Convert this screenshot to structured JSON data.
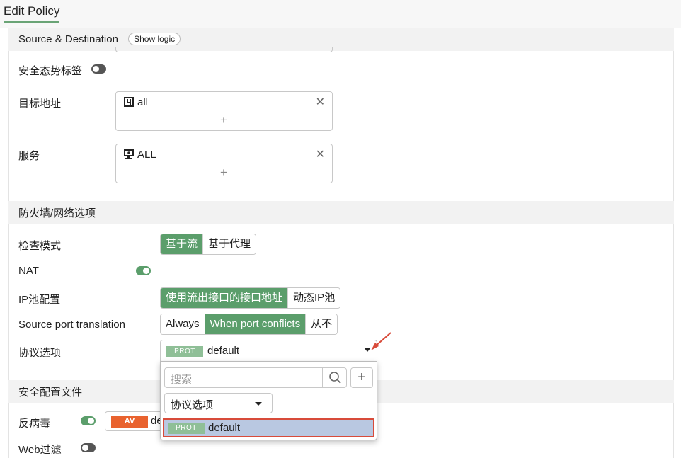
{
  "header": {
    "title": "Edit Policy"
  },
  "source_destination": {
    "heading": "Source & Destination",
    "show_logic": "Show logic",
    "security_tag": {
      "label": "安全态势标签",
      "enabled": false
    },
    "destination": {
      "label": "目标地址",
      "value": "all"
    },
    "service": {
      "label": "服务",
      "value": "ALL"
    }
  },
  "firewall": {
    "heading": "防火墙/网络选项",
    "inspection_mode": {
      "label": "检查模式",
      "options": [
        "基于流",
        "基于代理"
      ],
      "selected": "基于流"
    },
    "nat": {
      "label": "NAT",
      "enabled": true
    },
    "ip_pool": {
      "label": "IP池配置",
      "options": [
        "使用流出接口的接口地址",
        "动态IP池"
      ],
      "selected": "使用流出接口的接口地址"
    },
    "source_port": {
      "label": "Source port translation",
      "options": [
        "Always",
        "When port conflicts",
        "从不"
      ],
      "selected": "When port conflicts"
    },
    "protocol": {
      "label": "协议选项",
      "tag": "PROT",
      "value": "default"
    }
  },
  "dropdown": {
    "search_placeholder": "搜索",
    "add_symbol": "+",
    "filter_label": "协议选项",
    "options": [
      {
        "tag": "PROT",
        "label": "default"
      }
    ]
  },
  "security_profiles": {
    "heading": "安全配置文件",
    "antivirus": {
      "label": "反病毒",
      "enabled": true,
      "tag": "AV",
      "value": "de"
    },
    "web_filter": {
      "label": "Web过滤",
      "enabled": false
    }
  },
  "colors": {
    "accent_green": "#5b9e6b",
    "prot_tag": "#8fbf97",
    "av_tag": "#e9622e",
    "highlight": "#b9c8e1",
    "annotation_red": "#d84b3a"
  }
}
